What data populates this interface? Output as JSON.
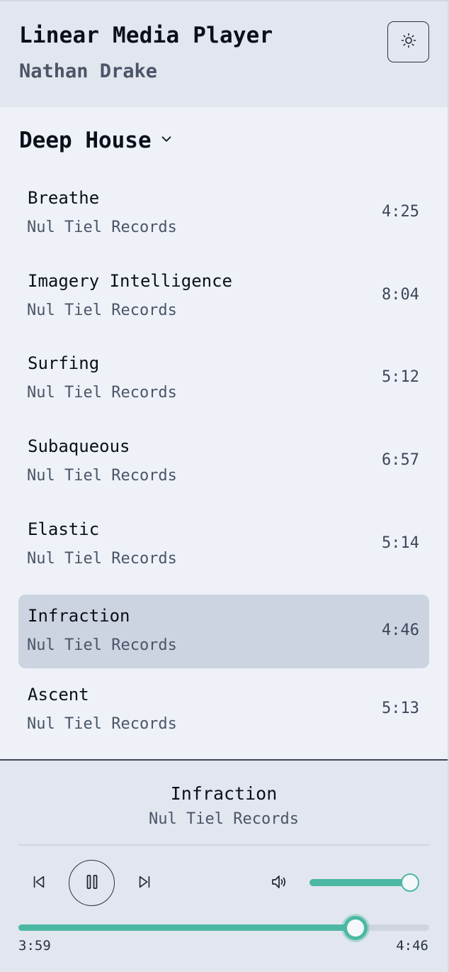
{
  "header": {
    "title": "Linear Media Player",
    "user": "Nathan Drake",
    "theme_icon": "sun-icon"
  },
  "playlist": {
    "name": "Deep House",
    "dropdown_icon": "chevron-down-icon",
    "tracks": [
      {
        "title": "Breathe",
        "artist": "Nul Tiel Records",
        "duration": "4:25",
        "active": false
      },
      {
        "title": "Imagery Intelligence",
        "artist": "Nul Tiel Records",
        "duration": "8:04",
        "active": false
      },
      {
        "title": "Surfing",
        "artist": "Nul Tiel Records",
        "duration": "5:12",
        "active": false
      },
      {
        "title": "Subaqueous",
        "artist": "Nul Tiel Records",
        "duration": "6:57",
        "active": false
      },
      {
        "title": "Elastic",
        "artist": "Nul Tiel Records",
        "duration": "5:14",
        "active": false
      },
      {
        "title": "Infraction",
        "artist": "Nul Tiel Records",
        "duration": "4:46",
        "active": true
      },
      {
        "title": "Ascent",
        "artist": "Nul Tiel Records",
        "duration": "5:13",
        "active": false
      }
    ]
  },
  "player": {
    "now_playing_title": "Infraction",
    "now_playing_artist": "Nul Tiel Records",
    "current_time": "3:59",
    "total_time": "4:46",
    "progress_fraction": 0.82,
    "volume_fraction": 1.0,
    "state": "playing",
    "icons": {
      "prev": "skip-back-icon",
      "play_pause": "pause-icon",
      "next": "skip-forward-icon",
      "volume": "volume-icon"
    }
  },
  "colors": {
    "accent": "#4cb8a3",
    "background": "#eef2f8",
    "header_bg": "#e2e7ef",
    "active_row": "#cdd4e1",
    "text_primary": "#0b0f1a",
    "text_secondary": "#4b5567"
  }
}
